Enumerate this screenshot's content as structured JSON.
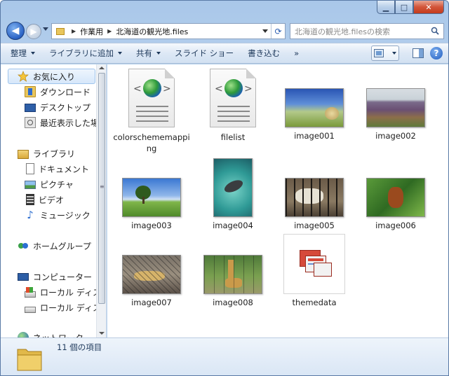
{
  "window": {
    "caption_buttons": [
      {
        "name": "minimize-button",
        "glyph": "▁"
      },
      {
        "name": "maximize-button",
        "glyph": "□"
      },
      {
        "name": "close-button",
        "glyph": "✕"
      }
    ]
  },
  "address": {
    "segments": [
      "作業用",
      "北海道の観光地.files"
    ],
    "back_glyph": "◀",
    "forward_glyph": "▶",
    "refresh_glyph": "⟳"
  },
  "search": {
    "placeholder": "北海道の観光地.filesの検索"
  },
  "toolbar": {
    "organize_label": "整理",
    "library_label": "ライブラリに追加",
    "share_label": "共有",
    "slideshow_label": "スライド ショー",
    "burn_label": "書き込む",
    "more_label": "»",
    "help_glyph": "?"
  },
  "nav": {
    "favorites": {
      "label": "お気に入り"
    },
    "favorites_items": [
      {
        "label": "ダウンロード",
        "icon": "download-folder-icon"
      },
      {
        "label": "デスクトップ",
        "icon": "desktop-icon"
      },
      {
        "label": "最近表示した場所",
        "icon": "recent-places-icon"
      }
    ],
    "libraries": {
      "label": "ライブラリ"
    },
    "libraries_items": [
      {
        "label": "ドキュメント",
        "icon": "documents-icon"
      },
      {
        "label": "ピクチャ",
        "icon": "pictures-icon"
      },
      {
        "label": "ビデオ",
        "icon": "videos-icon"
      },
      {
        "label": "ミュージック",
        "icon": "music-icon"
      }
    ],
    "homegroup": {
      "label": "ホームグループ"
    },
    "computer": {
      "label": "コンピューター"
    },
    "computer_items": [
      {
        "label": "ローカル ディスク (C:)",
        "icon": "local-disk-icon"
      },
      {
        "label": "ローカル ディスク (D:)",
        "icon": "local-disk-icon"
      }
    ],
    "network": {
      "label": "ネットワーク"
    }
  },
  "files": [
    {
      "name": "colorschememapping",
      "type": "xml-document"
    },
    {
      "name": "filelist",
      "type": "xml-document"
    },
    {
      "name": "image001",
      "type": "image",
      "scene": "field with hay bale under blue sky"
    },
    {
      "name": "image002",
      "type": "image",
      "scene": "lavender field rows"
    },
    {
      "name": "image003",
      "type": "image",
      "scene": "lone tree on green meadow"
    },
    {
      "name": "image004",
      "type": "image",
      "scene": "penguin swimming in tank"
    },
    {
      "name": "image005",
      "type": "image",
      "scene": "polar bear behind bars"
    },
    {
      "name": "image006",
      "type": "image",
      "scene": "orangutan in tree"
    },
    {
      "name": "image007",
      "type": "image",
      "scene": "snow leopard in cage"
    },
    {
      "name": "image008",
      "type": "image",
      "scene": "giraffe in enclosure"
    },
    {
      "name": "themedata",
      "type": "theme"
    }
  ],
  "status": {
    "count_text": "11 個の項目"
  },
  "colors": {
    "chrome_blue": "#c4dbf2",
    "toolbar_text": "#1e395b",
    "selected_nav": "#d6e7fa",
    "close_red": "#c43a1c"
  }
}
